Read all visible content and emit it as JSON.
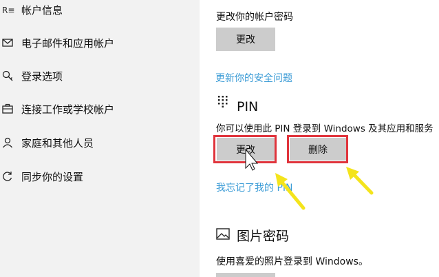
{
  "sidebar": {
    "items": [
      {
        "label": "帐户信息",
        "icon": "account-info-icon"
      },
      {
        "label": "电子邮件和应用帐户",
        "icon": "mail-icon"
      },
      {
        "label": "登录选项",
        "icon": "key-icon"
      },
      {
        "label": "连接工作或学校帐户",
        "icon": "briefcase-icon"
      },
      {
        "label": "家庭和其他人员",
        "icon": "person-icon"
      },
      {
        "label": "同步你的设置",
        "icon": "sync-icon"
      }
    ]
  },
  "password": {
    "heading": "更改你的帐户密码",
    "change_label": "更改",
    "security_link": "更新你的安全问题"
  },
  "pin": {
    "title": "PIN",
    "description": "你可以使用此 PIN 登录到 Windows 及其应用和服务",
    "change_label": "更改",
    "remove_label": "删除",
    "forgot_link": "我忘记了我的 PIN",
    "icon": "pin-keypad-icon"
  },
  "picture_password": {
    "title": "图片密码",
    "description": "使用喜爱的照片登录到 Windows。",
    "icon": "picture-icon"
  },
  "colors": {
    "highlight": "#e0343c",
    "arrow": "#f4e41c",
    "link": "#3a9bd6",
    "button": "#cccccc"
  }
}
